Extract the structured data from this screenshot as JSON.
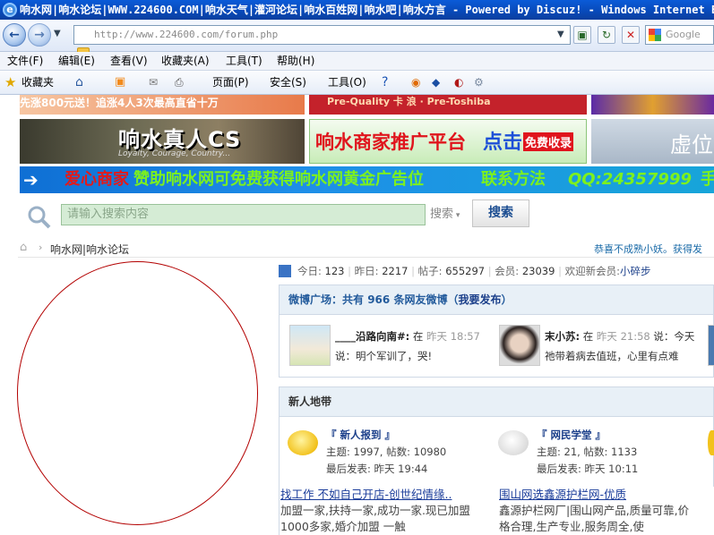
{
  "window": {
    "title": "响水网|响水论坛|WWW.224600.COM|响水天气|灌河论坛|响水百姓网|响水吧|响水方言 - Powered by Discuz! - Windows Internet Explorer"
  },
  "nav": {
    "back": "←",
    "forward": "→",
    "address": "http://www.224600.com/forum.php",
    "search_placeholder": "Google"
  },
  "menu": [
    "文件(F)",
    "编辑(E)",
    "查看(V)",
    "收藏夹(A)",
    "工具(T)",
    "帮助(H)"
  ],
  "favbar": {
    "favorites": "收藏夹",
    "page": "页面(P)",
    "safety": "安全(S)",
    "tools": "工具(O)"
  },
  "banners": {
    "top_left": "先涨800元送！追涨4人3次最高直省十万",
    "top_mid": "Pre-Quality 卡 浪 · Pre-Toshiba",
    "top_right": "",
    "cs_title": "响水真人CS",
    "cs_sub": "Loyalty, Courage, Country...",
    "promo": "响水商家推广平台",
    "promo_click": "点击",
    "promo_free": "免费收录",
    "vacant": "虚位",
    "ad_strip_1": "爱心商家",
    "ad_strip_2": "赞助响水网可免费获得响水网黄金广告位",
    "ad_strip_3": "联系方法",
    "ad_strip_4": "QQ:24357999",
    "ad_strip_5": "手"
  },
  "search": {
    "placeholder": "请输入搜索内容",
    "type": "搜索",
    "button": "搜索"
  },
  "breadcrumb": {
    "home": "响水网|响水论坛",
    "notice": "恭喜不成熟小妖。获得发"
  },
  "stats": {
    "today_label": "今日:",
    "today": "123",
    "yesterday_label": "昨日:",
    "yesterday": "2217",
    "posts_label": "帖子:",
    "posts": "655297",
    "members_label": "会员:",
    "members": "23039",
    "welcome": "欢迎新会员:",
    "new_member": "小碎步"
  },
  "weibo": {
    "header_prefix": "微博广场：共有",
    "count": "966",
    "header_suffix": "条网友微博（",
    "publish": "我要发布",
    "close": "）",
    "posts": [
      {
        "user": "____沿路向南#:",
        "verb": "在",
        "time": "昨天 18:57",
        "say": "说：",
        "text": "明个军训了，哭!"
      },
      {
        "user": "末小苏:",
        "verb": "在",
        "time": "昨天 21:58",
        "say": "说：今",
        "text": "天祂带着病去值班，心里有点难"
      }
    ]
  },
  "newbie": {
    "header": "新人地带",
    "forums": [
      {
        "name": "『 新人报到 』",
        "topics": "主题: 1997, 帖数: 10980",
        "last": "最后发表: 昨天 19:44"
      },
      {
        "name": "『 网民学堂 』",
        "topics": "主题: 21, 帖数: 1133",
        "last": "最后发表: 昨天 10:11"
      }
    ]
  },
  "ads": [
    {
      "title": "找工作 不如自己开店-创世纪情缘..",
      "line1": "加盟一家,扶持一家,成功一家.现已加盟",
      "line2": "1000多家,婚介加盟 一触"
    },
    {
      "title": "围山网选鑫源护栏网-优质",
      "line1": "鑫源护栏网厂|围山网产品,质量可靠,价",
      "line2": "格合理,生产专业,服务周全,使"
    }
  ]
}
